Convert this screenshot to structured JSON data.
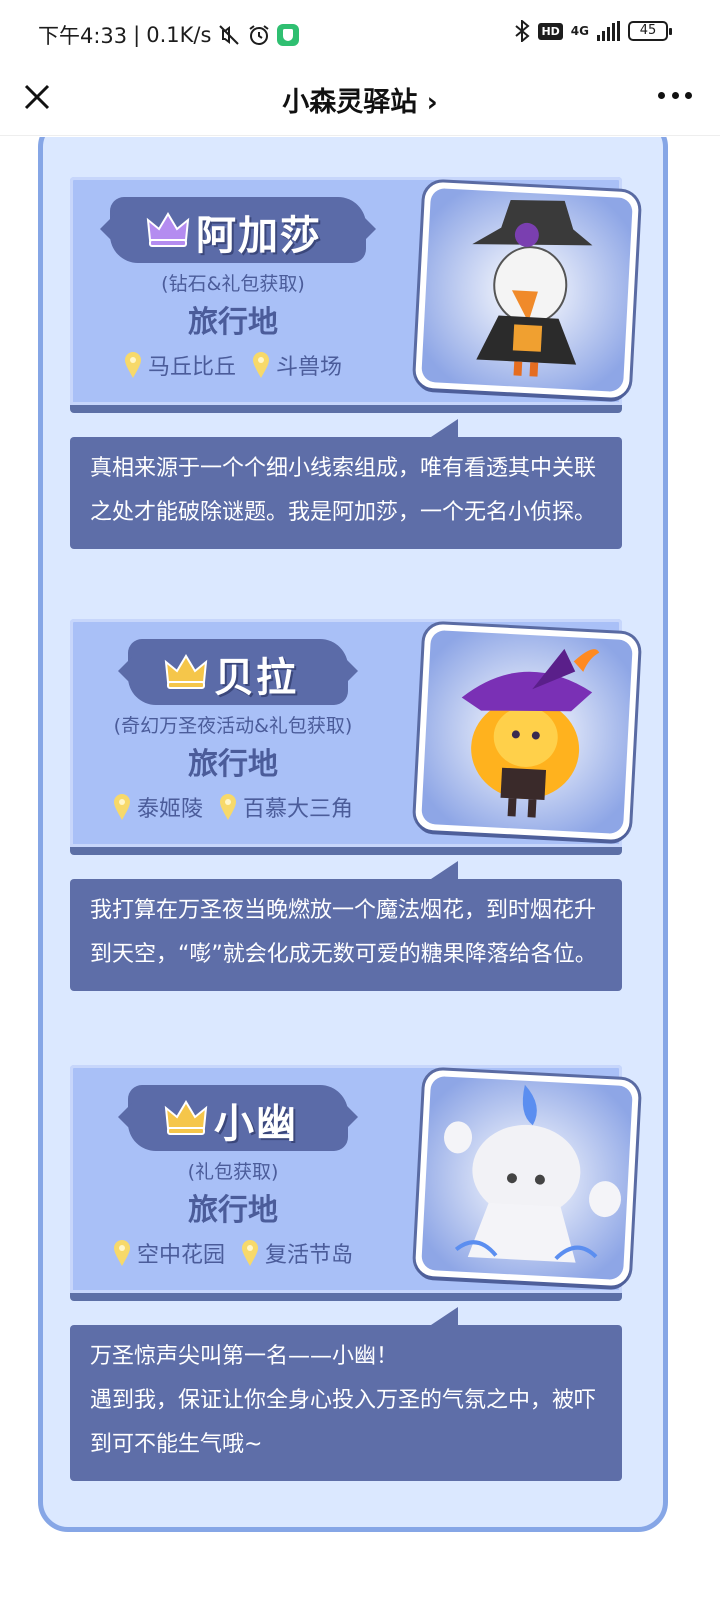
{
  "status_bar": {
    "time": "下午4:33",
    "speed": "0.1K/s",
    "hd": "HD",
    "network": "4G",
    "battery": "45"
  },
  "nav": {
    "title": "小森灵驿站 ›"
  },
  "colors": {
    "frame": "#86a6e6",
    "card": "#a9c0f7",
    "banner": "#5b6ba8",
    "speech": "#5e6ea8",
    "pin": "#f7d96a",
    "crown_purple": "#b48cf0",
    "crown_gold": "#f5c64a"
  },
  "cards": [
    {
      "name": "阿加莎",
      "crown_icon": "crown-purple-icon",
      "source": "(钻石&礼包获取)",
      "travel_title": "旅行地",
      "locations": [
        "马丘比丘",
        "斗兽场"
      ],
      "speech": "真相来源于一个个细小线索组成，唯有看透其中关联之处才能破除谜题。我是阿加莎，一个无名小侦探。"
    },
    {
      "name": "贝拉",
      "crown_icon": "crown-gold-icon",
      "source": "(奇幻万圣夜活动&礼包获取)",
      "travel_title": "旅行地",
      "locations": [
        "泰姬陵",
        "百慕大三角"
      ],
      "speech": "我打算在万圣夜当晚燃放一个魔法烟花，到时烟花升到天空，“嘭”就会化成无数可爱的糖果降落给各位。"
    },
    {
      "name": "小幽",
      "crown_icon": "crown-gold-icon",
      "source": "(礼包获取)",
      "travel_title": "旅行地",
      "locations": [
        "空中花园",
        "复活节岛"
      ],
      "speech": "万圣惊声尖叫第一名——小幽！\n遇到我，保证让你全身心投入万圣的气氛之中，被吓到可不能生气哦~"
    }
  ]
}
